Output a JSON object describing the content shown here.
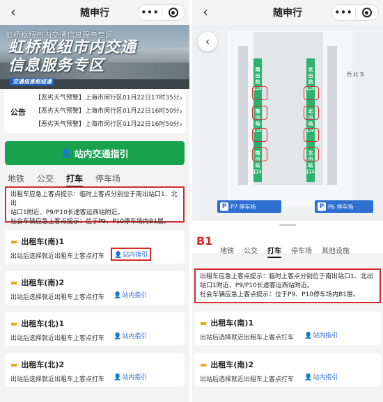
{
  "left": {
    "nav": {
      "title": "随申行",
      "back": "‹",
      "more": "•••"
    },
    "hero": {
      "subtitle": "虹桥枢纽市内交通信息服务专区",
      "title_line1": "虹桥枢纽市内交通",
      "title_line2": "信息服务专区",
      "tag": "交通信息枢纽通"
    },
    "notice": {
      "label": "公告",
      "items": [
        "【恶劣天气预警】上海市闵行区01月22日17时35分…",
        "【恶劣天气预警】上海市闵行区01月22日16时50分…",
        "【恶劣天气预警】上海市闵行区01月22日16时50分…"
      ]
    },
    "guide_button": {
      "icon": "👤",
      "label": "站内交通指引"
    },
    "tabs": [
      "地铁",
      "公交",
      "打车",
      "停车场"
    ],
    "active_tab": "打车",
    "tip_line1": "出租车应急上客点提示：临时上客点分别位于南出站口1、北出",
    "tip_line2": "站口1附近、P9/P10长途客运西站附近。",
    "tip_line3": "社会车辆应急上客点提示：位于P9、P10停车场内B1层。",
    "cards": [
      {
        "title": "出租车(南)1",
        "desc": "出站后选择就近出租车上客点打车",
        "guide": "站内指引"
      },
      {
        "title": "出租车(南)2",
        "desc": "出站后选择就近出租车上客点打车",
        "guide": "站内指引"
      },
      {
        "title": "出租车(北)1",
        "desc": "出站后选择就近出租车上客点打车",
        "guide": "站内指引"
      },
      {
        "title": "出租车(北)2",
        "desc": "出站后选择就近出租车上客点打车",
        "guide": "站内指引"
      }
    ]
  },
  "right": {
    "nav": {
      "title": "随申行",
      "back": "‹",
      "more": "•••"
    },
    "map": {
      "back": "‹",
      "exits_south": [
        "南出站口3",
        "南出站口2",
        "南出站口1"
      ],
      "exits_north": [
        "北出站口3",
        "北出站口2",
        "北出站口1"
      ],
      "parking_left": "P7 停车场",
      "parking_right": "P6 停车场",
      "compass": "西 北 东"
    },
    "floor": "B1",
    "tabs": [
      "地铁",
      "公交",
      "打车",
      "停车场",
      "其他设施"
    ],
    "active_tab": "打车",
    "tip_line1": "出租车应急上客点提示：临时上客点分别位于南出站口1、北出",
    "tip_line2": "站口1附近、P9/P10长途客运西站附近。",
    "tip_line3": "社会车辆应急上客点提示：位于P9、P10停车场内B1层。",
    "cards": [
      {
        "title": "出租车(南)1",
        "desc": "出站后选择就近出租车上客点打车",
        "guide": "站内指引"
      },
      {
        "title": "出租车(南)2",
        "desc": "出站后选择就近出租车上客点打车",
        "guide": "站内指引"
      }
    ]
  },
  "colors": {
    "accent_green": "#18a24d",
    "highlight_red": "#d42a2a",
    "link_blue": "#2b6bd6",
    "taxi_yellow": "#e6a81b"
  }
}
